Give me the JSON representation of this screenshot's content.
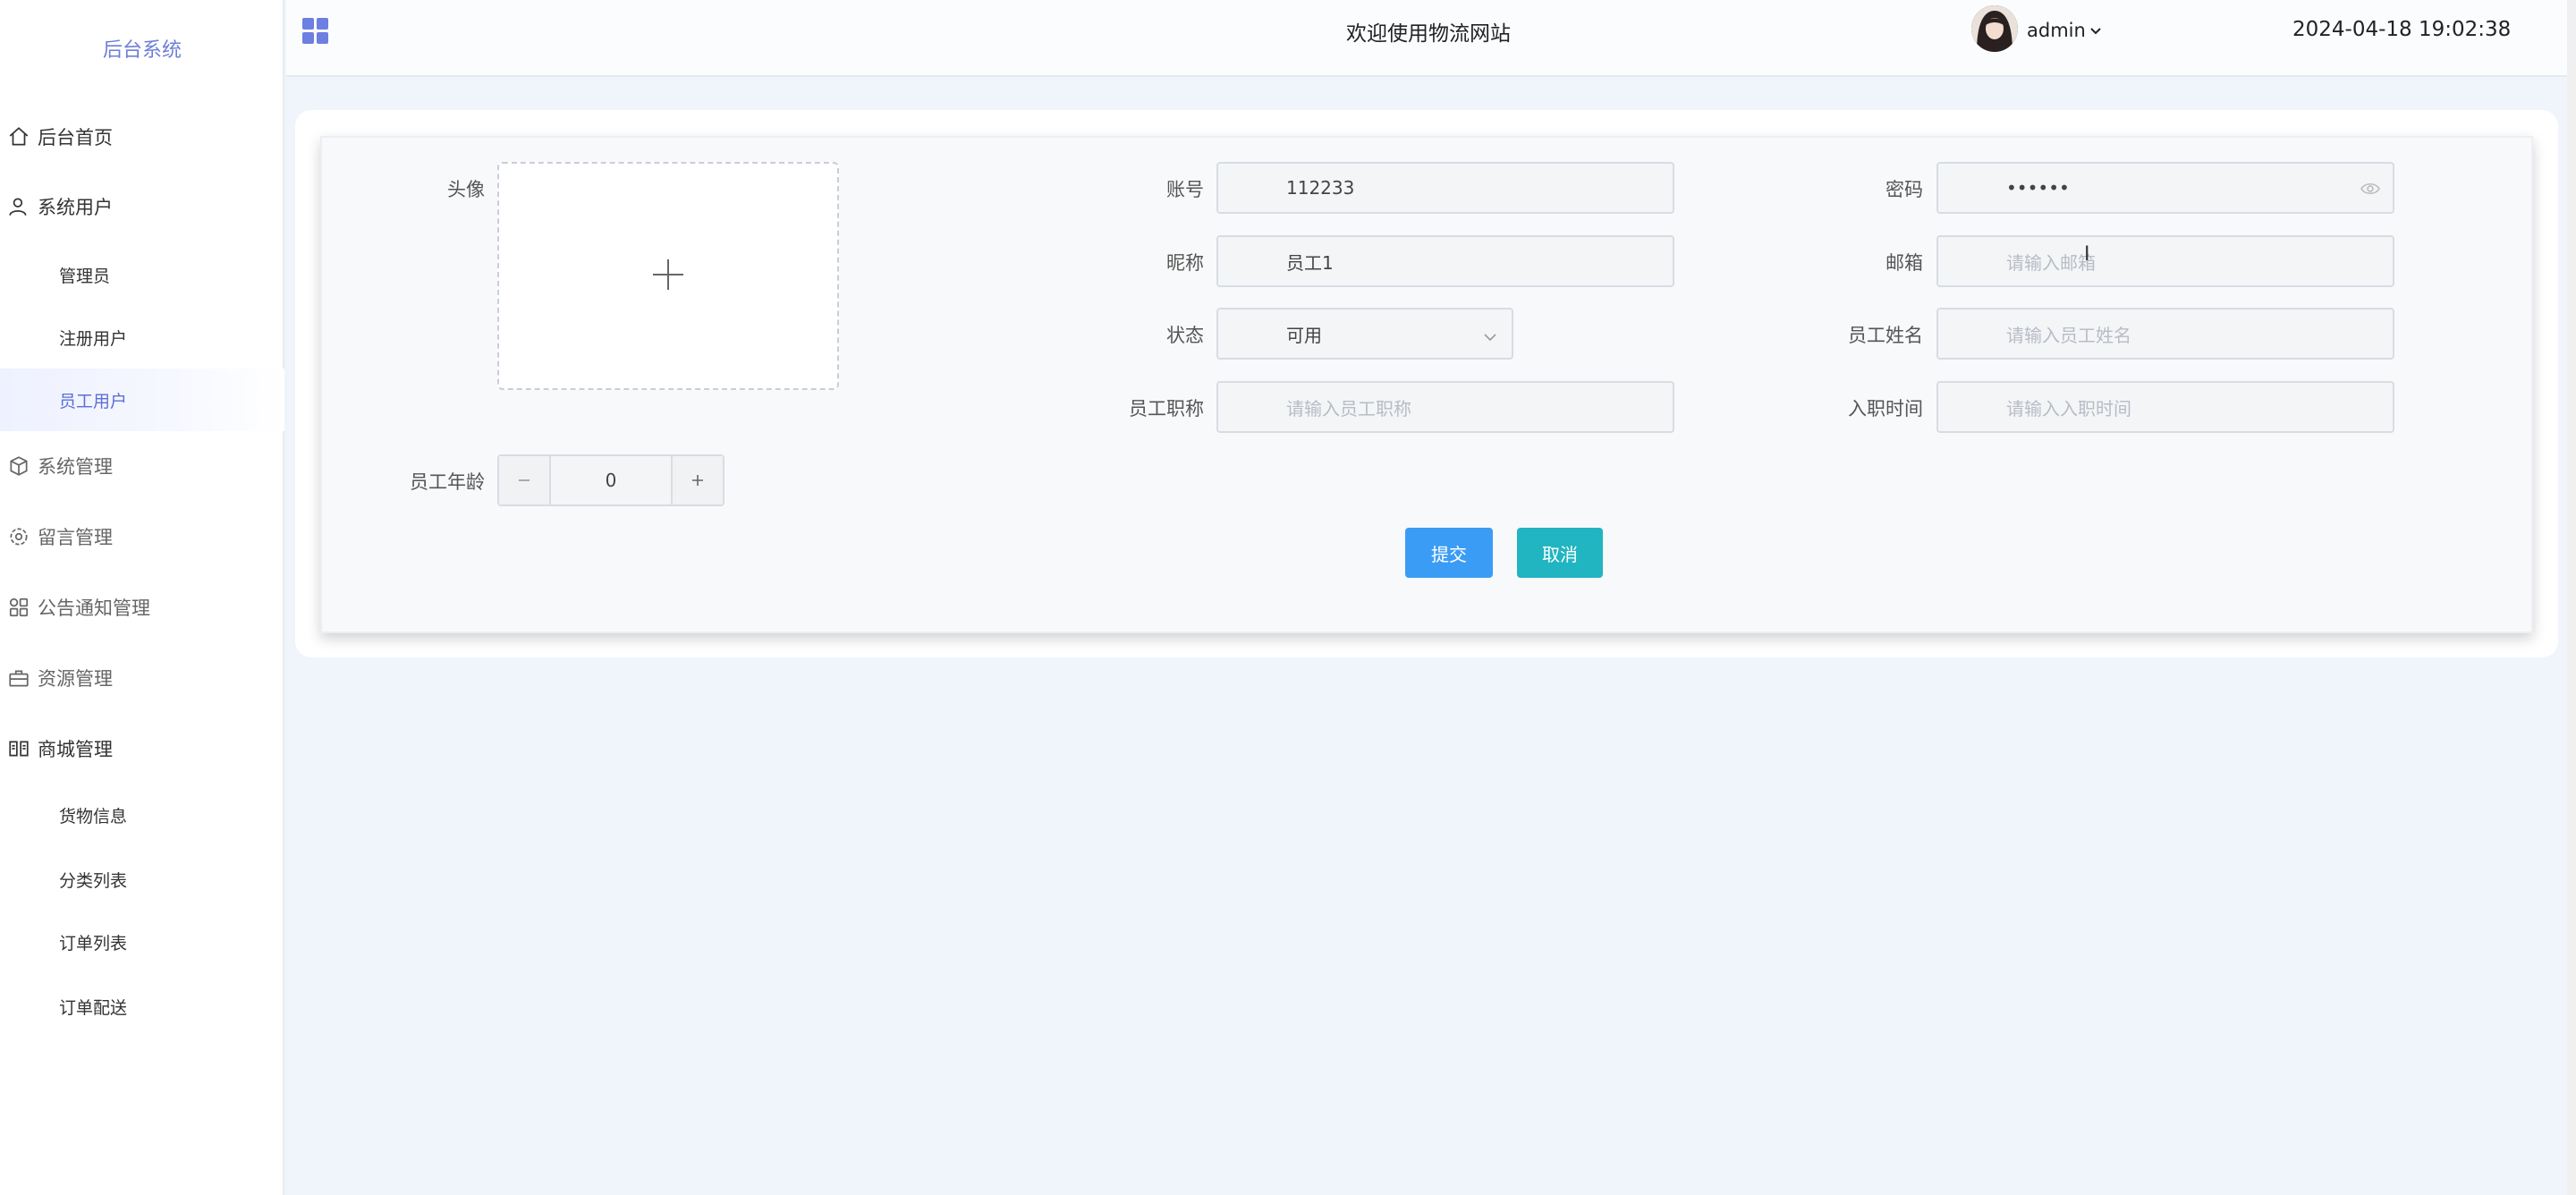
{
  "sidebar": {
    "brand": "后台系统",
    "menu": {
      "home": "后台首页",
      "system_users": "系统用户",
      "admins": "管理员",
      "registered_users": "注册用户",
      "staff_users": "员工用户",
      "system_manage": "系统管理",
      "messages_manage": "留言管理",
      "notices_manage": "公告通知管理",
      "resources_manage": "资源管理",
      "mall_manage": "商城管理",
      "goods_info": "货物信息",
      "category_list": "分类列表",
      "order_list": "订单列表",
      "order_delivery": "订单配送"
    }
  },
  "header": {
    "welcome": "欢迎使用物流网站",
    "user": "admin",
    "datetime": "2024-04-18 19:02:38"
  },
  "form": {
    "avatar_label": "头像",
    "account_label": "账号",
    "account_value": "112233",
    "password_label": "密码",
    "password_value": "••••••",
    "nickname_label": "昵称",
    "nickname_value": "员工1",
    "email_label": "邮箱",
    "email_placeholder": "请输入邮箱",
    "status_label": "状态",
    "status_value": "可用",
    "name_label": "员工姓名",
    "name_placeholder": "请输入员工姓名",
    "title_label": "员工职称",
    "title_placeholder": "请输入员工职称",
    "hire_label": "入职时间",
    "hire_placeholder": "请输入入职时间",
    "age_label": "员工年龄",
    "age_value": "0",
    "submit": "提交",
    "cancel": "取消"
  },
  "colors": {
    "accent": "#5b6fd6",
    "submit": "#3b9cf5",
    "cancel": "#20b5c0"
  },
  "icons": {
    "home": "home-icon",
    "users": "user-icon",
    "system": "cube-icon",
    "messages": "gear-icon",
    "notices": "grid-icon",
    "resources": "briefcase-icon",
    "mall": "book-icon"
  }
}
